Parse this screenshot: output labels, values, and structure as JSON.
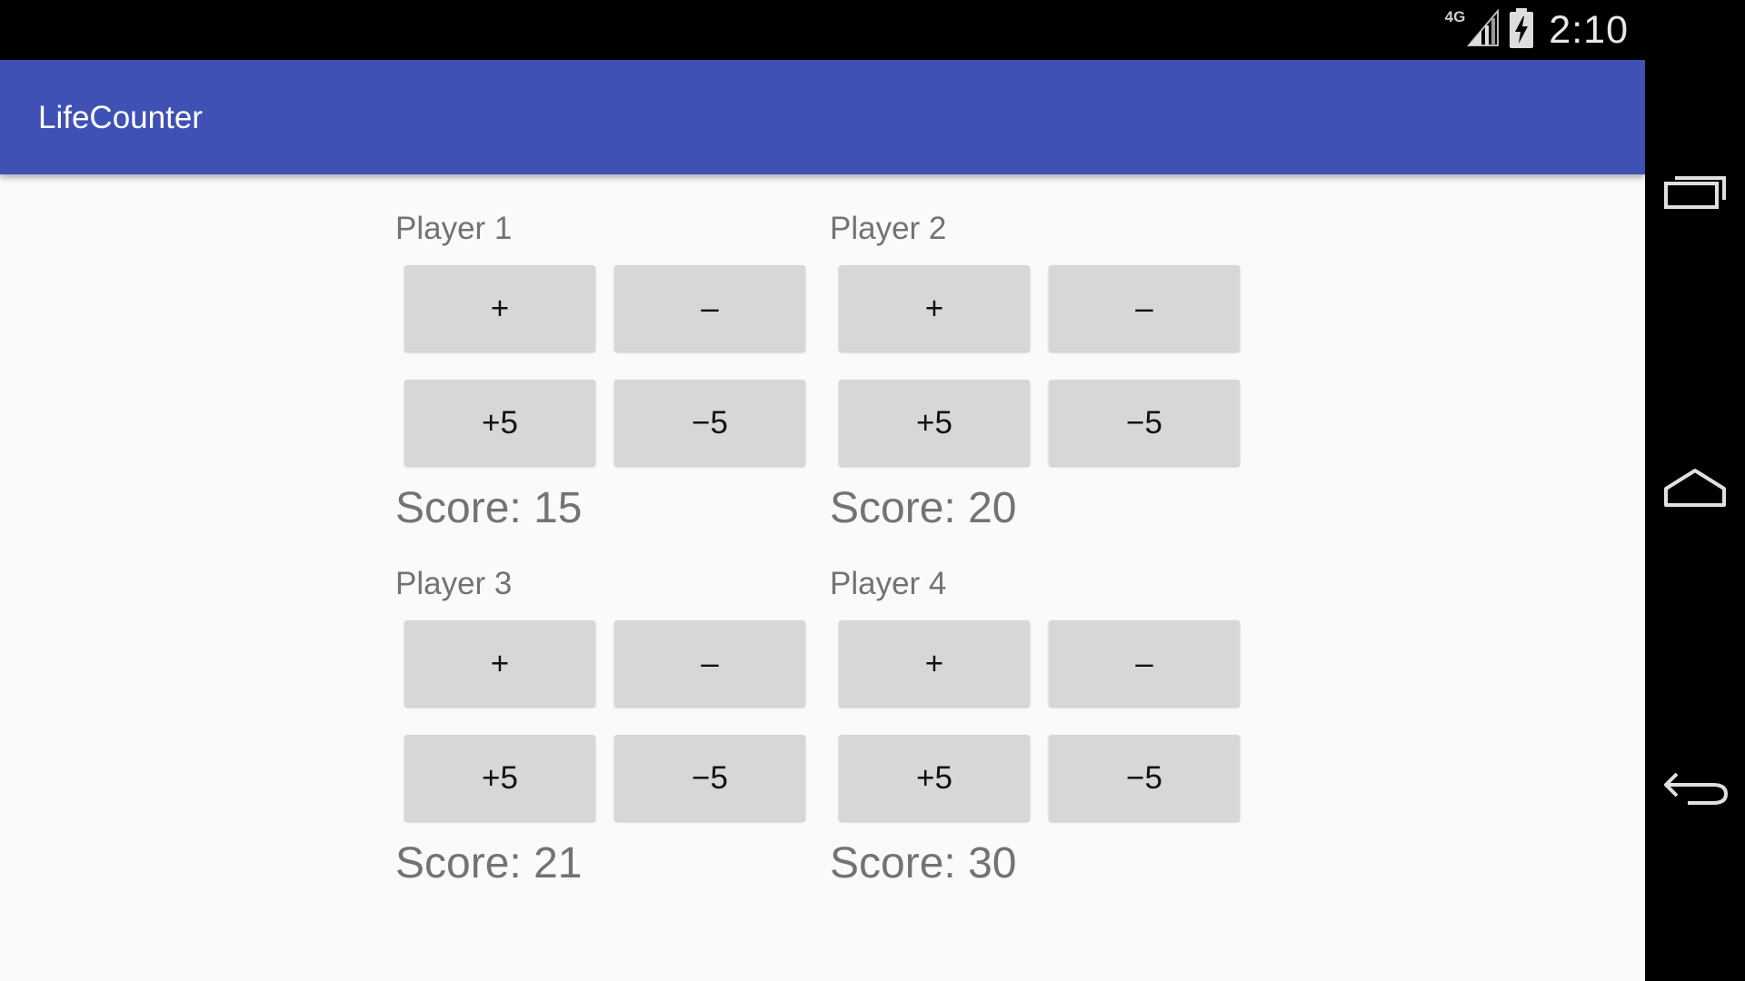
{
  "status_bar": {
    "network_type": "4G",
    "time": "2:10",
    "icons": [
      "signal-icon",
      "battery-charging-icon"
    ]
  },
  "app_bar": {
    "title": "LifeCounter",
    "color": "#3f51b5"
  },
  "players": [
    {
      "name": "Player 1",
      "score_text": "Score: 15",
      "buttons": {
        "plus": "+",
        "minus": "–",
        "plus5": "+5",
        "minus5": "−5"
      }
    },
    {
      "name": "Player 2",
      "score_text": "Score: 20",
      "buttons": {
        "plus": "+",
        "minus": "–",
        "plus5": "+5",
        "minus5": "−5"
      }
    },
    {
      "name": "Player 3",
      "score_text": "Score: 21",
      "buttons": {
        "plus": "+",
        "minus": "–",
        "plus5": "+5",
        "minus5": "−5"
      }
    },
    {
      "name": "Player 4",
      "score_text": "Score: 30",
      "buttons": {
        "plus": "+",
        "minus": "–",
        "plus5": "+5",
        "minus5": "−5"
      }
    }
  ],
  "nav_bar": {
    "icons": [
      "recent-apps-icon",
      "home-icon",
      "back-icon"
    ]
  }
}
